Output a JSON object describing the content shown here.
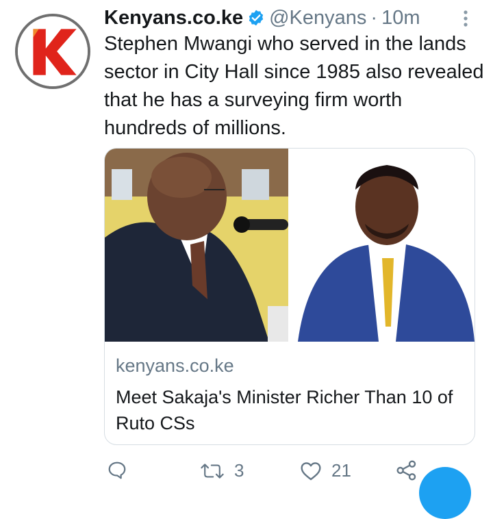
{
  "tweet": {
    "display_name": "Kenyans.co.ke",
    "handle": "@Kenyans",
    "separator": "·",
    "time": "10m",
    "text": "Stephen Mwangi who served in the lands sector in City Hall since 1985 also revealed that he has a surveying firm worth hundreds of millions.",
    "avatar_icon": "kenyans-k-logo-icon",
    "verified_icon": "verified-badge-icon"
  },
  "card": {
    "domain": "kenyans.co.ke",
    "title": "Meet Sakaja's Minister Richer Than 10 of Ruto CSs"
  },
  "actions": {
    "reply": {
      "icon": "reply-icon",
      "count": ""
    },
    "retweet": {
      "icon": "retweet-icon",
      "count": "3"
    },
    "like": {
      "icon": "heart-icon",
      "count": "21"
    },
    "share": {
      "icon": "share-icon",
      "count": ""
    }
  },
  "colors": {
    "brand_red": "#e0241b",
    "link_blue": "#1da1f2",
    "muted": "#657786"
  }
}
